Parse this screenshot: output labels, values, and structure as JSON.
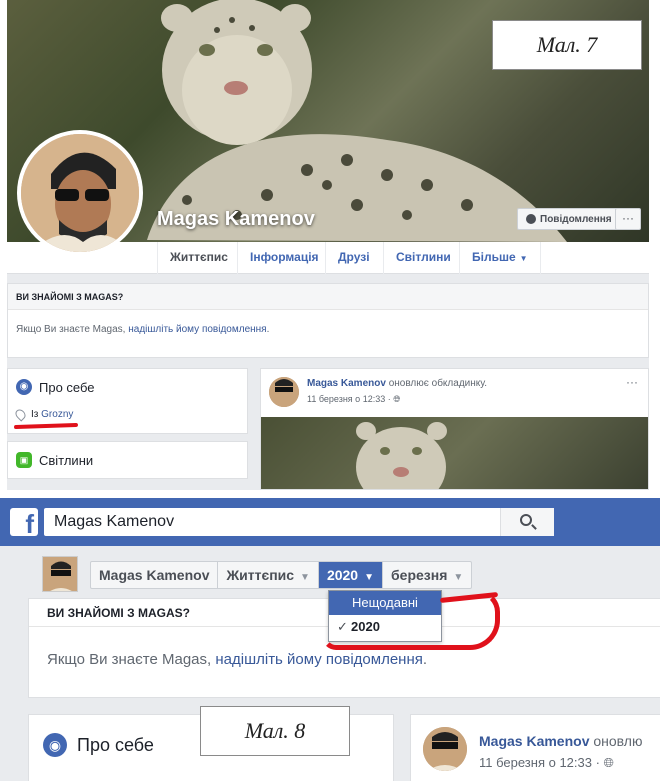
{
  "figure7_label": "Мал. 7",
  "figure8_label": "Мал. 8",
  "profile": {
    "name": "Magas Kamenov",
    "message_button": "Повідомлення",
    "more_button": "···"
  },
  "tabs": [
    {
      "label": "Життєпис"
    },
    {
      "label": "Інформація"
    },
    {
      "label": "Друзі"
    },
    {
      "label": "Світлини"
    },
    {
      "label": "Більше"
    }
  ],
  "know_box": {
    "heading": "ВИ ЗНАЙОМІ З MAGAS?",
    "text_prefix": "Якщо Ви знаєте Magas,",
    "link": "надішліть йому повідомлення",
    "text_suffix": "."
  },
  "about": {
    "title": "Про себе",
    "from_prefix": "Із",
    "from_city": "Grozny"
  },
  "photos": {
    "title": "Світлини"
  },
  "post": {
    "author": "Magas Kamenov",
    "action": "оновлює обкладинку.",
    "date": "11 березня о 12:33 ·",
    "menu": "···"
  },
  "search": {
    "value": "Magas Kamenov"
  },
  "breadcrumbs": {
    "name": "Magas Kamenov",
    "section": "Життєпис",
    "year": "2020",
    "month": "березня"
  },
  "dropdown": {
    "items": [
      "Нещодавні",
      "2020"
    ],
    "check": "✓"
  },
  "post2": {
    "author": "Magas Kamenov",
    "action": "оновлю",
    "date": "11 березня о 12:33 ·"
  },
  "colors": {
    "facebook_blue": "#4267b2",
    "annotation_red": "#e0111b"
  }
}
